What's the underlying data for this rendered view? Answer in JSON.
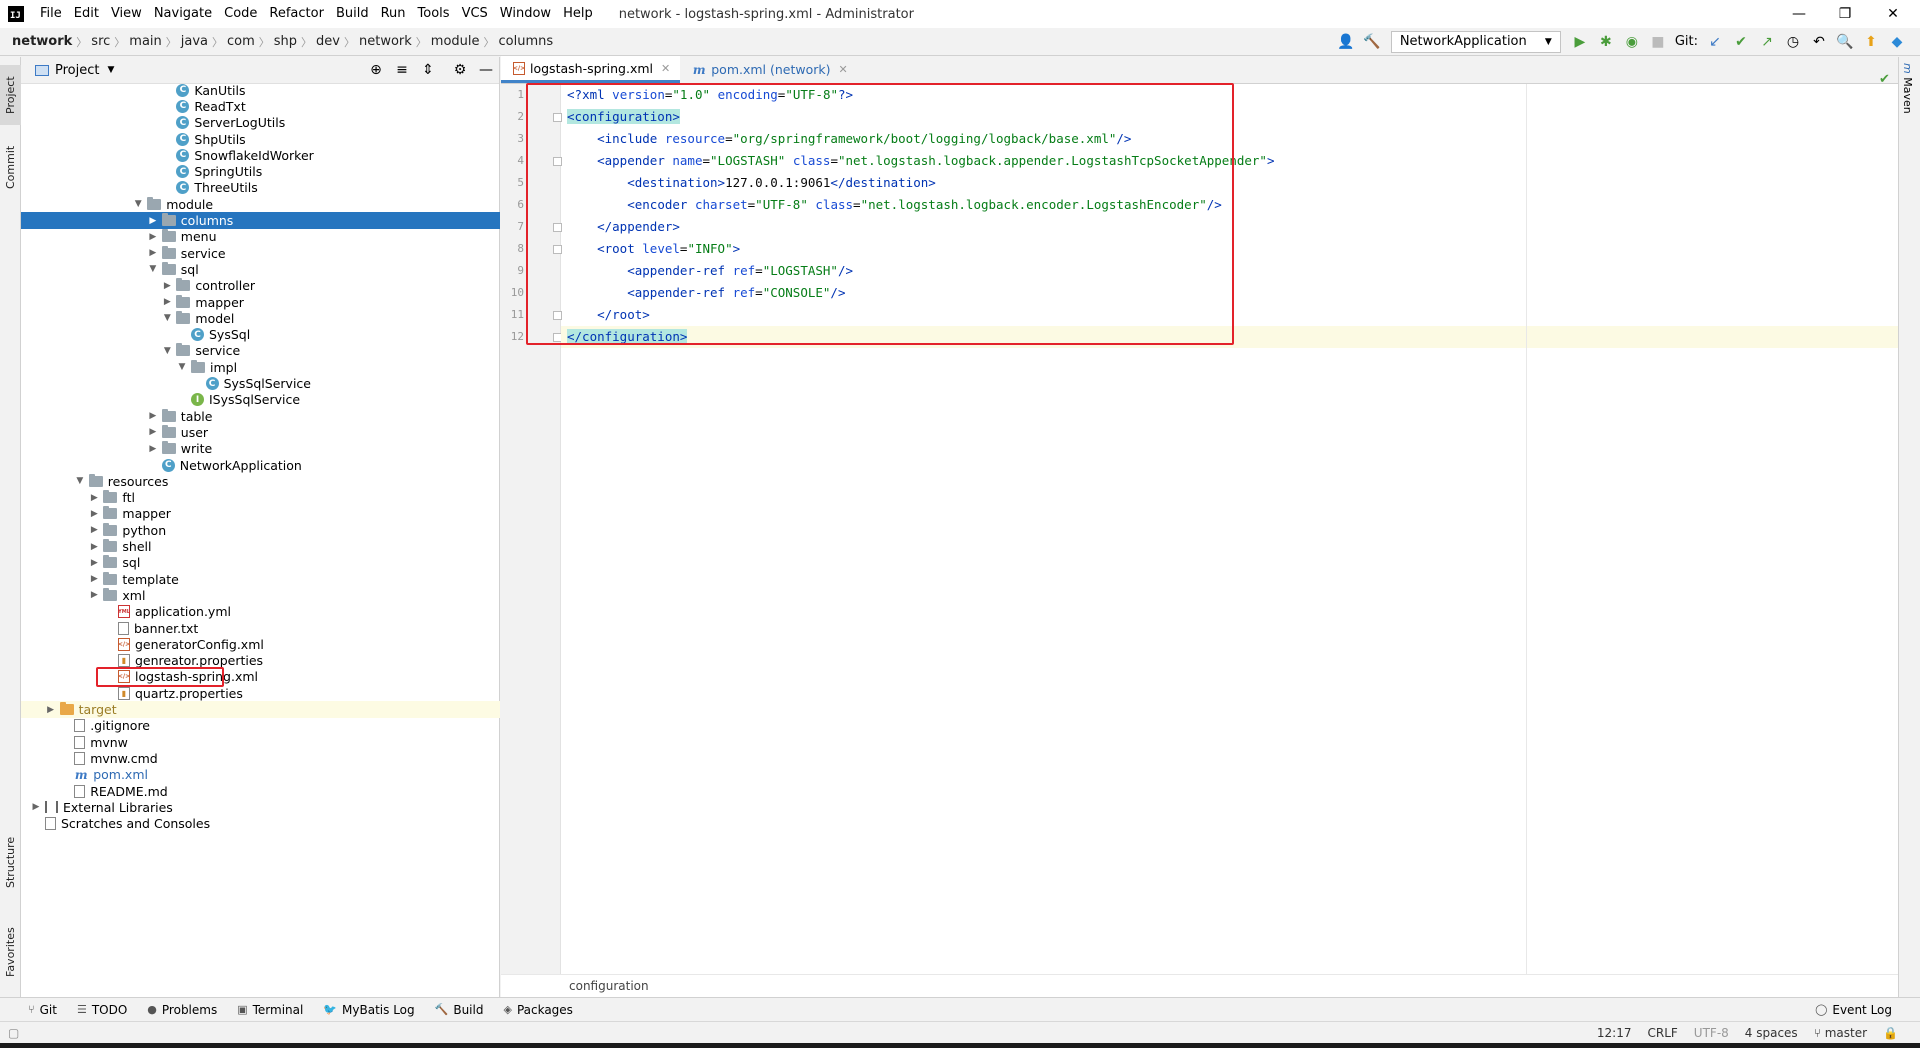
{
  "titlebar": {
    "logo": "IJ",
    "menu": [
      "File",
      "Edit",
      "View",
      "Navigate",
      "Code",
      "Refactor",
      "Build",
      "Run",
      "Tools",
      "VCS",
      "Window",
      "Help"
    ],
    "title": "network - logstash-spring.xml - Administrator",
    "controls": {
      "minimize": "—",
      "restore": "❐",
      "close": "✕"
    }
  },
  "navbar": {
    "breadcrumbs": [
      "network",
      "src",
      "main",
      "java",
      "com",
      "shp",
      "dev",
      "network",
      "module",
      "columns"
    ],
    "run_config": "NetworkApplication",
    "git_label": "Git:"
  },
  "left_stripe": {
    "tabs": [
      "Project",
      "Commit",
      "Structure",
      "Favorites"
    ]
  },
  "project": {
    "title": "Project",
    "tree": [
      {
        "label": "KanUtils",
        "icon": "class",
        "indent": 9,
        "arrow": ""
      },
      {
        "label": "ReadTxt",
        "icon": "class",
        "indent": 9,
        "arrow": ""
      },
      {
        "label": "ServerLogUtils",
        "icon": "class",
        "indent": 9,
        "arrow": ""
      },
      {
        "label": "ShpUtils",
        "icon": "class",
        "indent": 9,
        "arrow": ""
      },
      {
        "label": "SnowflakeIdWorker",
        "icon": "class",
        "indent": 9,
        "arrow": ""
      },
      {
        "label": "SpringUtils",
        "icon": "class",
        "indent": 9,
        "arrow": ""
      },
      {
        "label": "ThreeUtils",
        "icon": "class",
        "indent": 9,
        "arrow": ""
      },
      {
        "label": "module",
        "icon": "folder",
        "indent": 7,
        "arrow": "down"
      },
      {
        "label": "columns",
        "icon": "folder",
        "indent": 8,
        "arrow": "right",
        "selected": true
      },
      {
        "label": "menu",
        "icon": "folder",
        "indent": 8,
        "arrow": "right"
      },
      {
        "label": "service",
        "icon": "folder",
        "indent": 8,
        "arrow": "right"
      },
      {
        "label": "sql",
        "icon": "folder",
        "indent": 8,
        "arrow": "down"
      },
      {
        "label": "controller",
        "icon": "folder",
        "indent": 9,
        "arrow": "right"
      },
      {
        "label": "mapper",
        "icon": "folder",
        "indent": 9,
        "arrow": "right"
      },
      {
        "label": "model",
        "icon": "folder",
        "indent": 9,
        "arrow": "down"
      },
      {
        "label": "SysSql",
        "icon": "class",
        "indent": 10,
        "arrow": ""
      },
      {
        "label": "service",
        "icon": "folder",
        "indent": 9,
        "arrow": "down"
      },
      {
        "label": "impl",
        "icon": "folder",
        "indent": 10,
        "arrow": "down"
      },
      {
        "label": "SysSqlService",
        "icon": "class",
        "indent": 11,
        "arrow": ""
      },
      {
        "label": "ISysSqlService",
        "icon": "interface",
        "indent": 10,
        "arrow": ""
      },
      {
        "label": "table",
        "icon": "folder",
        "indent": 8,
        "arrow": "right"
      },
      {
        "label": "user",
        "icon": "folder",
        "indent": 8,
        "arrow": "right"
      },
      {
        "label": "write",
        "icon": "folder",
        "indent": 8,
        "arrow": "right"
      },
      {
        "label": "NetworkApplication",
        "icon": "class",
        "indent": 8,
        "arrow": ""
      },
      {
        "label": "resources",
        "icon": "folder",
        "indent": 3,
        "arrow": "down"
      },
      {
        "label": "ftl",
        "icon": "folder",
        "indent": 4,
        "arrow": "right"
      },
      {
        "label": "mapper",
        "icon": "folder",
        "indent": 4,
        "arrow": "right"
      },
      {
        "label": "python",
        "icon": "folder",
        "indent": 4,
        "arrow": "right"
      },
      {
        "label": "shell",
        "icon": "folder",
        "indent": 4,
        "arrow": "right"
      },
      {
        "label": "sql",
        "icon": "folder",
        "indent": 4,
        "arrow": "right"
      },
      {
        "label": "template",
        "icon": "folder",
        "indent": 4,
        "arrow": "right"
      },
      {
        "label": "xml",
        "icon": "folder",
        "indent": 4,
        "arrow": "right"
      },
      {
        "label": "application.yml",
        "icon": "yml",
        "indent": 5,
        "arrow": ""
      },
      {
        "label": "banner.txt",
        "icon": "file",
        "indent": 5,
        "arrow": ""
      },
      {
        "label": "generatorConfig.xml",
        "icon": "xml",
        "indent": 5,
        "arrow": ""
      },
      {
        "label": "genreator.properties",
        "icon": "prop",
        "indent": 5,
        "arrow": ""
      },
      {
        "label": "logstash-spring.xml",
        "icon": "xml",
        "indent": 5,
        "arrow": "",
        "boxed": true
      },
      {
        "label": "quartz.properties",
        "icon": "prop",
        "indent": 5,
        "arrow": ""
      },
      {
        "label": "target",
        "icon": "folder-orange",
        "indent": 1,
        "arrow": "right",
        "highlight": true
      },
      {
        "label": ".gitignore",
        "icon": "file",
        "indent": 2,
        "arrow": ""
      },
      {
        "label": "mvnw",
        "icon": "file",
        "indent": 2,
        "arrow": ""
      },
      {
        "label": "mvnw.cmd",
        "icon": "file",
        "indent": 2,
        "arrow": ""
      },
      {
        "label": "pom.xml",
        "icon": "maven",
        "indent": 2,
        "arrow": ""
      },
      {
        "label": "README.md",
        "icon": "file",
        "indent": 2,
        "arrow": ""
      },
      {
        "label": "External Libraries",
        "icon": "lib",
        "indent": 0,
        "arrow": "right"
      },
      {
        "label": "Scratches and Consoles",
        "icon": "file",
        "indent": 0,
        "arrow": ""
      }
    ]
  },
  "editor": {
    "tabs": [
      {
        "label": "logstash-spring.xml",
        "icon": "xml",
        "active": true
      },
      {
        "label": "pom.xml (network)",
        "icon": "maven",
        "active": false
      }
    ],
    "lines": [
      [
        [
          "pi",
          "<?"
        ],
        [
          "tag",
          "xml "
        ],
        [
          "attr",
          "version"
        ],
        [
          "plain",
          "="
        ],
        [
          "val",
          "\"1.0\""
        ],
        [
          "plain",
          " "
        ],
        [
          "attr",
          "encoding"
        ],
        [
          "plain",
          "="
        ],
        [
          "val",
          "\"UTF-8\""
        ],
        [
          "pi",
          "?>"
        ]
      ],
      [
        [
          "taghl",
          "<configuration>"
        ]
      ],
      [
        [
          "plain",
          "    "
        ],
        [
          "tag",
          "<include "
        ],
        [
          "attr",
          "resource"
        ],
        [
          "plain",
          "="
        ],
        [
          "val",
          "\"org/springframework/boot/logging/logback/base.xml\""
        ],
        [
          "tag",
          "/>"
        ]
      ],
      [
        [
          "plain",
          "    "
        ],
        [
          "tag",
          "<appender "
        ],
        [
          "attr",
          "name"
        ],
        [
          "plain",
          "="
        ],
        [
          "val",
          "\"LOGSTASH\""
        ],
        [
          "plain",
          " "
        ],
        [
          "attr",
          "class"
        ],
        [
          "plain",
          "="
        ],
        [
          "val",
          "\"net.logstash.logback.appender.LogstashTcpSocketAppender\""
        ],
        [
          "tag",
          ">"
        ]
      ],
      [
        [
          "plain",
          "        "
        ],
        [
          "tag",
          "<destination>"
        ],
        [
          "plain",
          "127.0.0.1:9061"
        ],
        [
          "tag",
          "</destination>"
        ]
      ],
      [
        [
          "plain",
          "        "
        ],
        [
          "tag",
          "<encoder "
        ],
        [
          "attr",
          "charset"
        ],
        [
          "plain",
          "="
        ],
        [
          "val",
          "\"UTF-8\""
        ],
        [
          "plain",
          " "
        ],
        [
          "attr",
          "class"
        ],
        [
          "plain",
          "="
        ],
        [
          "val",
          "\"net.logstash.logback.encoder.LogstashEncoder\""
        ],
        [
          "tag",
          "/>"
        ]
      ],
      [
        [
          "plain",
          "    "
        ],
        [
          "tag",
          "</appender>"
        ]
      ],
      [
        [
          "plain",
          "    "
        ],
        [
          "tag",
          "<root "
        ],
        [
          "attr",
          "level"
        ],
        [
          "plain",
          "="
        ],
        [
          "val",
          "\"INFO\""
        ],
        [
          "tag",
          ">"
        ]
      ],
      [
        [
          "plain",
          "        "
        ],
        [
          "tag",
          "<appender-ref "
        ],
        [
          "attr",
          "ref"
        ],
        [
          "plain",
          "="
        ],
        [
          "val",
          "\"LOGSTASH\""
        ],
        [
          "tag",
          "/>"
        ]
      ],
      [
        [
          "plain",
          "        "
        ],
        [
          "tag",
          "<appender-ref "
        ],
        [
          "attr",
          "ref"
        ],
        [
          "plain",
          "="
        ],
        [
          "val",
          "\"CONSOLE\""
        ],
        [
          "tag",
          "/>"
        ]
      ],
      [
        [
          "plain",
          "    "
        ],
        [
          "tag",
          "</root>"
        ]
      ],
      [
        [
          "taghl",
          "</configuration>"
        ]
      ]
    ],
    "line_numbers": [
      "1",
      "2",
      "3",
      "4",
      "5",
      "6",
      "7",
      "8",
      "9",
      "10",
      "11",
      "12"
    ],
    "breadcrumb": "configuration"
  },
  "right_stripe": {
    "tab": "Maven"
  },
  "bottom_bar": {
    "tabs": [
      {
        "label": "Git",
        "icon": "⑂"
      },
      {
        "label": "TODO",
        "icon": "☰"
      },
      {
        "label": "Problems",
        "icon": "●"
      },
      {
        "label": "Terminal",
        "icon": "▣"
      },
      {
        "label": "MyBatis Log",
        "icon": "🐦"
      },
      {
        "label": "Build",
        "icon": "🔨"
      },
      {
        "label": "Packages",
        "icon": "◈"
      }
    ],
    "event_log": "Event Log"
  },
  "status_bar": {
    "position": "12:17",
    "line_sep": "CRLF",
    "encoding": "UTF-8",
    "indent": "4 spaces",
    "branch": "master"
  },
  "colors": {
    "selection": "#2675bf",
    "annotation_red": "#e3222a",
    "tag": "#0033b3",
    "attr_value": "#067d17"
  }
}
